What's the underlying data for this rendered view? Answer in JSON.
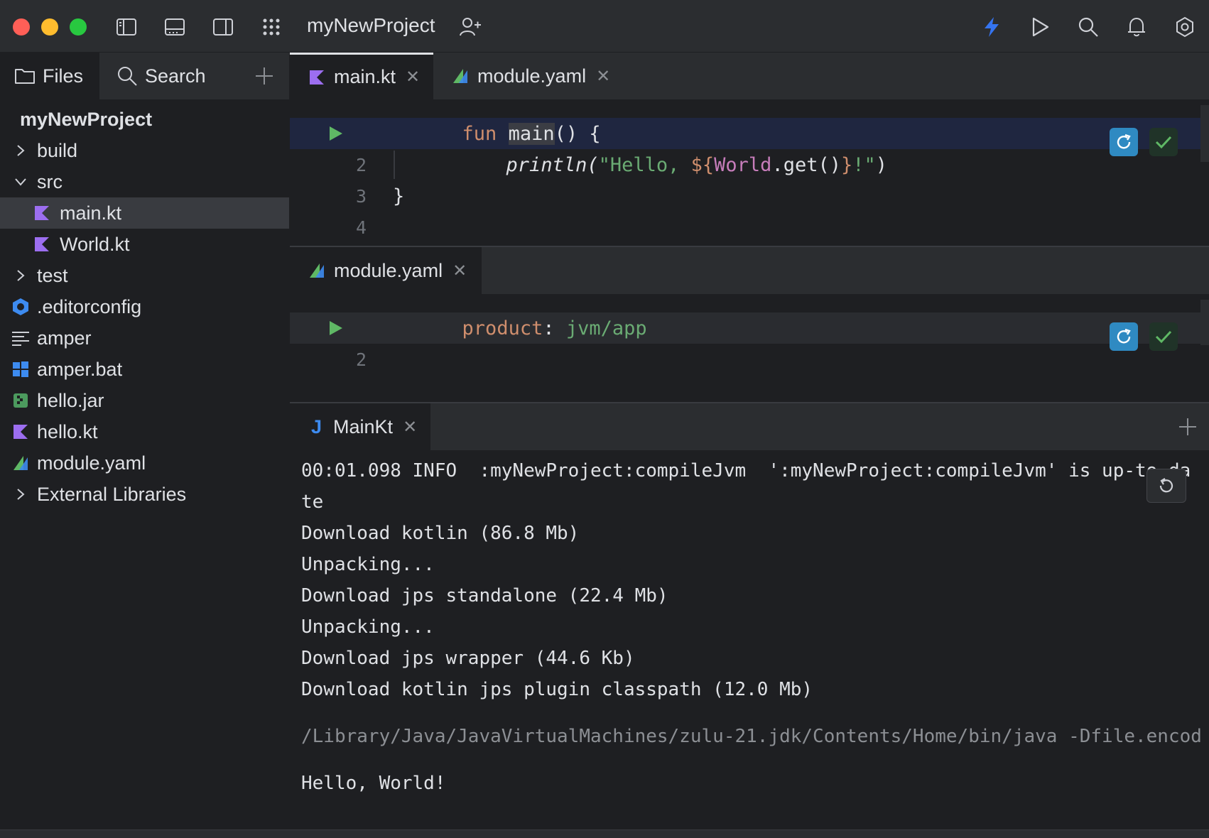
{
  "titlebar": {
    "project_name": "myNewProject",
    "icons": [
      "sidebar-left-icon",
      "panel-bottom-icon",
      "sidebar-right-icon",
      "apps-grid-icon",
      "add-user-icon",
      "bolt-icon",
      "run-icon",
      "search-icon",
      "bell-icon",
      "settings-icon"
    ]
  },
  "sidebar": {
    "tabs": {
      "files": "Files",
      "search": "Search"
    },
    "project_root": "myNewProject",
    "items": [
      {
        "label": "build",
        "type": "folder",
        "expanded": false
      },
      {
        "label": "src",
        "type": "folder",
        "expanded": true
      },
      {
        "label": "main.kt",
        "type": "kotlin",
        "selected": true
      },
      {
        "label": "World.kt",
        "type": "kotlin"
      },
      {
        "label": "test",
        "type": "folder",
        "expanded": false
      },
      {
        "label": ".editorconfig",
        "type": "editorconfig"
      },
      {
        "label": "amper",
        "type": "text"
      },
      {
        "label": "amper.bat",
        "type": "windows"
      },
      {
        "label": "hello.jar",
        "type": "jar"
      },
      {
        "label": "hello.kt",
        "type": "kotlin"
      },
      {
        "label": "module.yaml",
        "type": "yaml"
      },
      {
        "label": "External Libraries",
        "type": "folder",
        "expanded": false
      }
    ]
  },
  "editor_top": {
    "tabs": [
      {
        "label": "main.kt",
        "active": true
      },
      {
        "label": "module.yaml",
        "active": false
      }
    ],
    "lines": {
      "l2": "2",
      "l3": "3",
      "l4": "4",
      "fun_kw": "fun",
      "main_name": "main",
      "main_rest": "() {",
      "println": "println(",
      "str_open": "\"Hello, ",
      "interp_open": "${",
      "world": "World",
      "get": ".get()",
      "interp_close": "}",
      "str_close": "!\"",
      "paren_close": ")",
      "brace_close": "}"
    }
  },
  "editor_bottom": {
    "tab": "module.yaml",
    "lines": {
      "l2": "2",
      "key": "product",
      "colon": ": ",
      "value": "jvm/app"
    }
  },
  "console": {
    "tab": "MainKt",
    "tab_prefix": "J",
    "lines": [
      "00:01.098 INFO  :myNewProject:compileJvm  ':myNewProject:compileJvm' is up-to-da",
      "te",
      "Download kotlin (86.8 Mb)",
      "Unpacking...",
      "Download jps standalone (22.4 Mb)",
      "Unpacking...",
      "Download jps wrapper (44.6 Kb)",
      "Download kotlin jps plugin classpath (12.0 Mb)",
      "/Library/Java/JavaVirtualMachines/zulu-21.jdk/Contents/Home/bin/java -Dfile.encod",
      "Hello, World!"
    ]
  },
  "colors": {
    "accent": "#3574f0",
    "run_green": "#5fb865",
    "kotlin_purple": "#9c6ef0"
  }
}
